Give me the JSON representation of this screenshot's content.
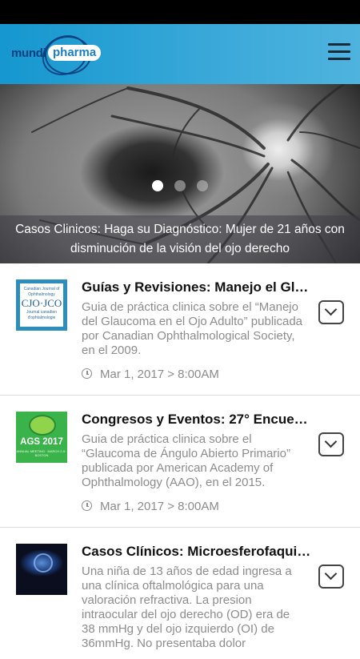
{
  "header": {
    "logo": {
      "part1": "mundi",
      "part2": "pharma"
    },
    "menu_icon": "hamburger-menu-icon"
  },
  "hero": {
    "caption": "Casos Clinicos: Haga su Diagnóstico: Mujer de 21 años con disminución de la visión del ojo derecho",
    "slide_count": 3,
    "active_slide": 1
  },
  "articles": [
    {
      "thumbnail": {
        "text": "CJO·JCO",
        "small_top": "Canadian Journal of Ophthalmology",
        "small_bottom": "Journal canadien d'ophtalmologie"
      },
      "title": "Guías y Revisiones: Manejo el Gla...",
      "description": "Guia de práctica clinica sobre el “Manejo del Glaucoma en el Ojo Adulto” publicada por Canadian Ophthalmological Society, en el 2009.",
      "date": "Mar 1, 2017 > 8:00AM"
    },
    {
      "thumbnail": {
        "text": "AGS 2017",
        "small": "ANNUAL MEETING · MARCH 2-5 · BOSTON"
      },
      "title": "Congresos y Eventos: 27° Encuent...",
      "description": "Guia de práctica clinica sobre el “Glaucoma de Ángulo Abierto Primario” publicada por American Academy of Ophthalmology (AAO), en el 2015.",
      "date": "Mar 1, 2017 > 8:00AM"
    },
    {
      "title": "Casos Clínicos: Microesferofaquia...",
      "description": "Una niña de 13 años de edad ingresa a una clínica oftalmológica para una valoración refractiva. La presion intraocular del ojo derecho (OD) era de 38 mmHg y del ojo izquierdo (OI) de 36mmHg. No presentaba dolor"
    }
  ]
}
